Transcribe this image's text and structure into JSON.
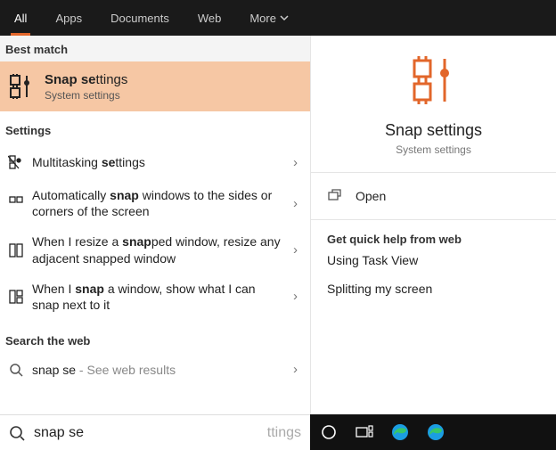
{
  "tabs": {
    "all": "All",
    "apps": "Apps",
    "documents": "Documents",
    "web": "Web",
    "more": "More"
  },
  "best_match_header": "Best match",
  "best_match": {
    "title_prefix_bold": "Snap se",
    "title_suffix": "ttings",
    "subtitle": "System settings"
  },
  "settings_header": "Settings",
  "settings_items": [
    {
      "pre": "Multitasking ",
      "bold": "se",
      "post": "ttings"
    },
    {
      "pre": "Automatically ",
      "bold": "snap",
      "post": " windows to the sides or corners of the screen"
    },
    {
      "pre": "When I resize a ",
      "bold": "snap",
      "post": "ped window, resize any adjacent snapped window"
    },
    {
      "pre": "When I ",
      "bold": "snap",
      "post": " a window, show what I can snap next to it"
    }
  ],
  "search_web_header": "Search the web",
  "web_item": {
    "query": "snap se",
    "suffix": " - See web results"
  },
  "preview": {
    "title": "Snap settings",
    "subtitle": "System settings"
  },
  "actions": {
    "open": "Open"
  },
  "quick_help": {
    "header": "Get quick help from web",
    "links": [
      "Using Task View",
      "Splitting my screen"
    ]
  },
  "search_input": {
    "value": "snap se",
    "placeholder": "ttings"
  }
}
